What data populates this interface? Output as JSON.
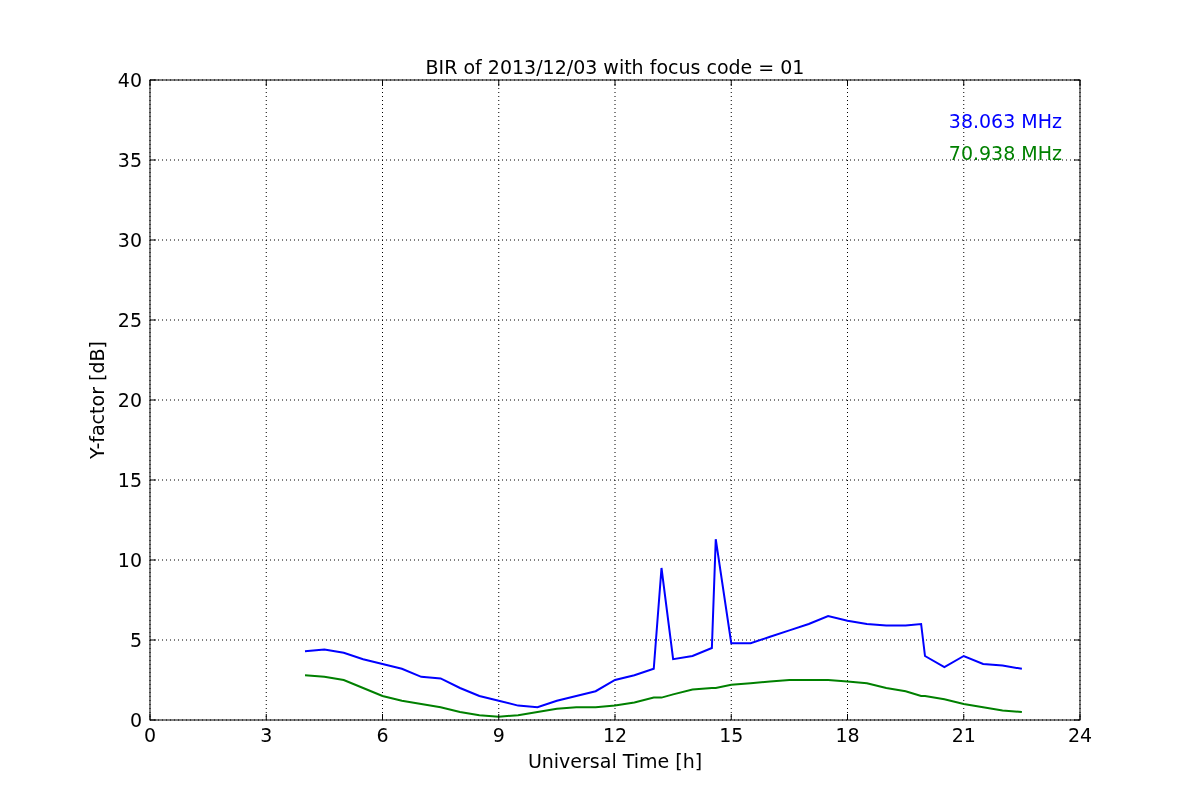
{
  "chart_data": {
    "type": "line",
    "title": "BIR of 2013/12/03 with focus code = 01",
    "xlabel": "Universal Time [h]",
    "ylabel": "Y-factor [dB]",
    "x": [
      4,
      4.5,
      5,
      5.5,
      6,
      6.5,
      7,
      7.5,
      8,
      8.5,
      9,
      9.5,
      10,
      10.5,
      11,
      11.5,
      12,
      12.5,
      13,
      13.2,
      13.5,
      14,
      14.5,
      14.6,
      15,
      15.5,
      16,
      16.5,
      17,
      17.5,
      18,
      18.5,
      19,
      19.5,
      19.9,
      20,
      20.5,
      21,
      21.5,
      22,
      22.5
    ],
    "series": [
      {
        "name": "38.063 MHz",
        "color": "#0000ff",
        "values": [
          4.3,
          4.4,
          4.2,
          3.8,
          3.5,
          3.2,
          2.7,
          2.6,
          2.0,
          1.5,
          1.2,
          0.9,
          0.8,
          1.2,
          1.5,
          1.8,
          2.5,
          2.8,
          3.2,
          9.5,
          3.8,
          4.0,
          4.5,
          11.3,
          4.8,
          4.8,
          5.2,
          5.6,
          6.0,
          6.5,
          6.2,
          6.0,
          5.9,
          5.9,
          6.0,
          4.0,
          3.3,
          4.0,
          3.5,
          3.4,
          3.2
        ]
      },
      {
        "name": "70.938 MHz",
        "color": "#008000",
        "values": [
          2.8,
          2.7,
          2.5,
          2.0,
          1.5,
          1.2,
          1.0,
          0.8,
          0.5,
          0.3,
          0.2,
          0.3,
          0.5,
          0.7,
          0.8,
          0.8,
          0.9,
          1.1,
          1.4,
          1.4,
          1.6,
          1.9,
          2.0,
          2.0,
          2.2,
          2.3,
          2.4,
          2.5,
          2.5,
          2.5,
          2.4,
          2.3,
          2.0,
          1.8,
          1.5,
          1.5,
          1.3,
          1.0,
          0.8,
          0.6,
          0.5
        ]
      }
    ],
    "xlim": [
      0,
      24
    ],
    "ylim": [
      0,
      40
    ],
    "xticks": [
      0,
      3,
      6,
      9,
      12,
      15,
      18,
      21,
      24
    ],
    "yticks": [
      0,
      5,
      10,
      15,
      20,
      25,
      30,
      35,
      40
    ],
    "grid": true
  }
}
